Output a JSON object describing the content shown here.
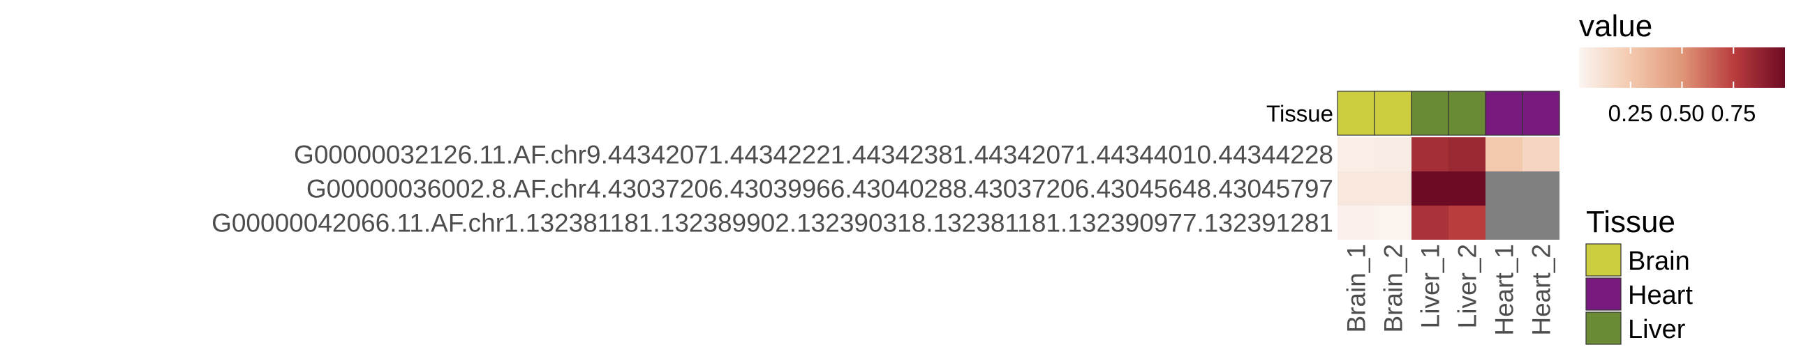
{
  "chart_data": {
    "type": "heatmap",
    "rows": [
      "G00000032126.11.AF.chr9.44342071.44342221.44342381.44342071.44344010.44344228",
      "G00000036002.8.AF.chr4.43037206.43039966.43040288.43037206.43045648.43045797",
      "G00000042066.11.AF.chr1.132381181.132389902.132390318.132381181.132390977.132391281"
    ],
    "columns": [
      "Brain_1",
      "Brain_2",
      "Liver_1",
      "Liver_2",
      "Heart_1",
      "Heart_2"
    ],
    "values": [
      [
        0.04,
        0.05,
        0.82,
        0.85,
        0.25,
        0.18
      ],
      [
        0.08,
        0.08,
        1.0,
        1.0,
        null,
        null
      ],
      [
        0.02,
        0.01,
        0.8,
        0.75,
        null,
        null
      ]
    ],
    "missing_color": "#808080",
    "annotation": {
      "title": "Tissue",
      "values": [
        "Brain",
        "Brain",
        "Liver",
        "Liver",
        "Heart",
        "Heart"
      ],
      "colors": {
        "Brain": "#CDCD40",
        "Heart": "#761A7E",
        "Liver": "#6B8A36"
      }
    },
    "color_scale": {
      "title": "value",
      "colors": [
        "#FBF5F1",
        "#F3C9AE",
        "#E09678",
        "#B93D3E",
        "#6E0B24"
      ],
      "range": [
        0,
        1
      ],
      "ticks": [
        "0.25",
        "0.50",
        "0.75"
      ],
      "tick_values": [
        0.25,
        0.5,
        0.75
      ]
    },
    "tissue_legend": {
      "title": "Tissue",
      "items": [
        "Brain",
        "Heart",
        "Liver"
      ]
    }
  }
}
